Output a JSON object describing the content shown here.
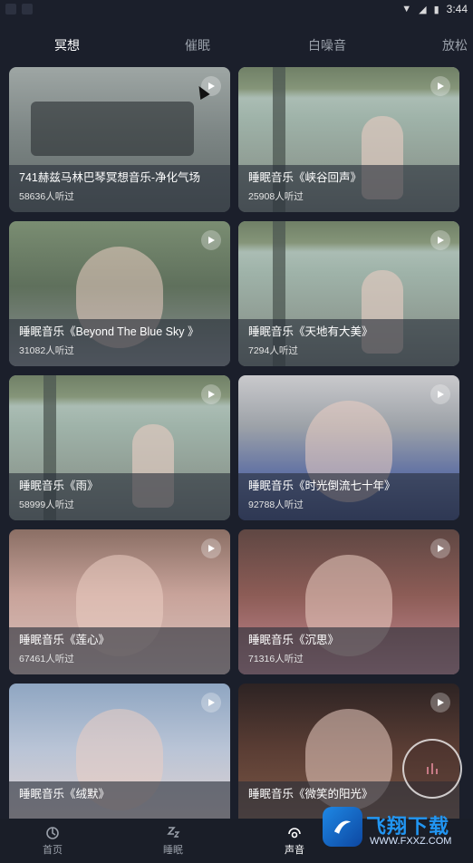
{
  "status_bar": {
    "time": "3:44"
  },
  "tabs": [
    {
      "label": "冥想",
      "active": true
    },
    {
      "label": "催眠",
      "active": false
    },
    {
      "label": "白噪音",
      "active": false
    },
    {
      "label": "放松",
      "active": false
    }
  ],
  "cards": [
    {
      "title": "741赫兹马林巴琴冥想音乐-净化气场",
      "listeners": "58636人听过"
    },
    {
      "title": "睡眠音乐《峡谷回声》",
      "listeners": "25908人听过"
    },
    {
      "title": "睡眠音乐《Beyond The Blue Sky 》",
      "listeners": "31082人听过"
    },
    {
      "title": "睡眠音乐《天地有大美》",
      "listeners": "7294人听过"
    },
    {
      "title": "睡眠音乐《雨》",
      "listeners": "58999人听过"
    },
    {
      "title": "睡眠音乐《时光倒流七十年》",
      "listeners": "92788人听过"
    },
    {
      "title": "睡眠音乐《莲心》",
      "listeners": "67461人听过"
    },
    {
      "title": "睡眠音乐《沉思》",
      "listeners": "71316人听过"
    },
    {
      "title": "睡眠音乐《绒默》",
      "listeners": ""
    },
    {
      "title": "睡眠音乐《微笑的阳光》",
      "listeners": ""
    }
  ],
  "bottom_nav": [
    {
      "label": "首页",
      "icon": "home-icon",
      "active": false
    },
    {
      "label": "睡眠",
      "icon": "sleep-icon",
      "active": false
    },
    {
      "label": "声音",
      "icon": "sound-icon",
      "active": true
    }
  ],
  "watermark": {
    "title": "飞翔下载",
    "subtitle": "WWW.FXXZ.COM"
  },
  "colors": {
    "background": "#1b1f2b",
    "active_tab": "#ffffff",
    "inactive_tab": "#9aa0aa"
  }
}
